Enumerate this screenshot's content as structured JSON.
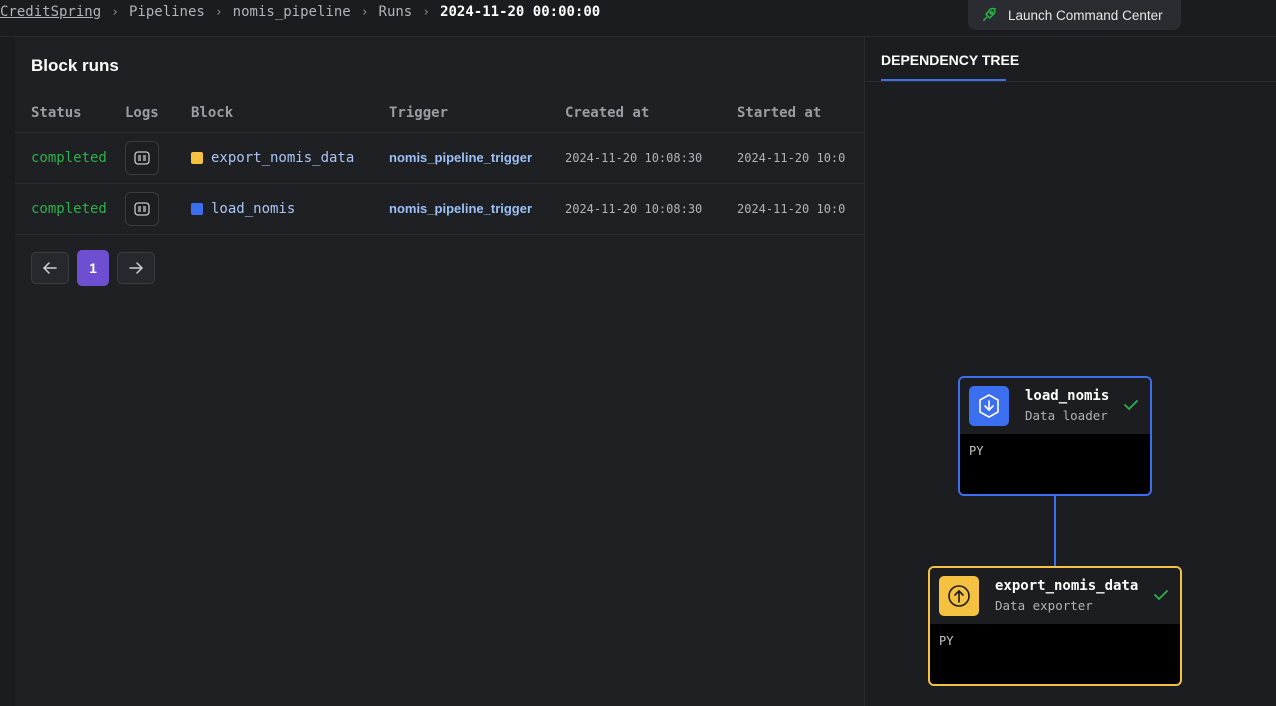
{
  "breadcrumb": {
    "project": "CreditSpring",
    "pipelines": "Pipelines",
    "pipeline": "nomis_pipeline",
    "runs": "Runs",
    "run": "2024-11-20 00:00:00"
  },
  "launch_button": {
    "label": "Launch Command Center",
    "icon": "rocket-icon"
  },
  "block_runs": {
    "title": "Block runs",
    "columns": [
      "Status",
      "Logs",
      "Block",
      "Trigger",
      "Created at",
      "Started at"
    ],
    "rows": [
      {
        "status": "completed",
        "block": "export_nomis_data",
        "block_color": "#f5c141",
        "trigger": "nomis_pipeline_trigger",
        "created_at": "2024-11-20 10:08:30",
        "started_at": "2024-11-20 10:0"
      },
      {
        "status": "completed",
        "block": "load_nomis",
        "block_color": "#3c6ef0",
        "trigger": "nomis_pipeline_trigger",
        "created_at": "2024-11-20 10:08:30",
        "started_at": "2024-11-20 10:0"
      }
    ]
  },
  "pagination": {
    "current_page": "1",
    "prev_icon": "arrow-left-icon",
    "next_icon": "arrow-right-icon"
  },
  "dependency_tree": {
    "tab": "DEPENDENCY TREE",
    "nodes": [
      {
        "name": "load_nomis",
        "type": "Data loader",
        "lang": "PY",
        "color": "#3c6ef0",
        "icon": "download-icon",
        "status": "check-icon"
      },
      {
        "name": "export_nomis_data",
        "type": "Data exporter",
        "lang": "PY",
        "color": "#f5c141",
        "icon": "upload-icon",
        "status": "check-icon"
      }
    ]
  },
  "colors": {
    "accent": "#6f4fd1",
    "success": "#29b34a",
    "loader": "#3c6ef0",
    "exporter": "#f5c141"
  }
}
